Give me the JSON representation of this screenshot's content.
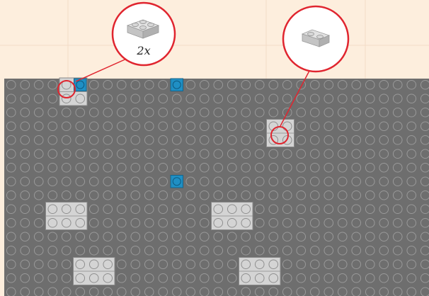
{
  "colors": {
    "background": "#fdeedd",
    "guide_line": "#f3dcc6",
    "baseplate": "#6e6e6e",
    "baseplate_edge": "#5a5a5a",
    "stud_outline": "#9a9a9a",
    "light_brick": "#d4d4d4",
    "light_brick_outline": "#8a8a8a",
    "blue_tile": "#1f8fc4",
    "callout_ring": "#e0252f",
    "callout_fill": "#ffffff"
  },
  "callouts": [
    {
      "id": "callout-left",
      "part": "light-gray-plate-2x2-icon",
      "quantity_label": "2x"
    },
    {
      "id": "callout-right",
      "part": "light-gray-plate-1x2-icon",
      "quantity_label": ""
    }
  ],
  "baseplate": {
    "columns": 30,
    "rows": 15
  },
  "parts": [
    {
      "name": "plate-2x2-light-gray-top-left",
      "color": "light_brick",
      "col": 4,
      "row": 0,
      "w": 2,
      "h": 2
    },
    {
      "name": "plate-2x2-light-gray-right",
      "color": "light_brick",
      "col": 19,
      "row": 3,
      "w": 2,
      "h": 2
    },
    {
      "name": "plate-2x3-light-gray-left",
      "color": "light_brick",
      "col": 3,
      "row": 9,
      "w": 3,
      "h": 2
    },
    {
      "name": "plate-2x3-light-gray-center",
      "color": "light_brick",
      "col": 15,
      "row": 9,
      "w": 3,
      "h": 2
    },
    {
      "name": "plate-2x3-light-gray-bottom-left",
      "color": "light_brick",
      "col": 5,
      "row": 13,
      "w": 3,
      "h": 2
    },
    {
      "name": "plate-2x3-light-gray-bottom-right",
      "color": "light_brick",
      "col": 17,
      "row": 13,
      "w": 3,
      "h": 2
    },
    {
      "name": "tile-1x1-blue-a",
      "color": "blue_tile",
      "col": 5,
      "row": 0,
      "w": 1,
      "h": 1
    },
    {
      "name": "tile-1x1-blue-b",
      "color": "blue_tile",
      "col": 12,
      "row": 0,
      "w": 1,
      "h": 1
    },
    {
      "name": "tile-1x1-blue-c",
      "color": "blue_tile",
      "col": 12,
      "row": 7,
      "w": 1,
      "h": 1
    }
  ]
}
